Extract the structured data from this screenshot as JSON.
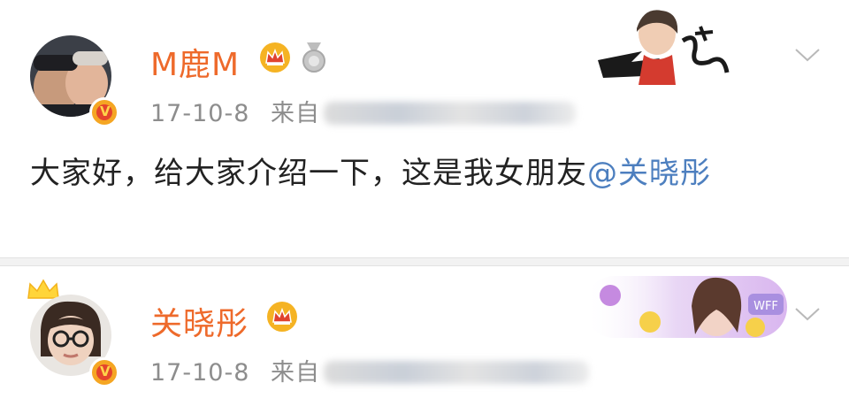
{
  "posts": [
    {
      "username": "M鹿M",
      "timestamp": "17-10-8",
      "source_prefix": "来自",
      "body_prefix": "大家好，给大家介绍一下，这是我女朋友",
      "mention": "@关晓彤"
    },
    {
      "username": "关晓彤",
      "timestamp": "17-10-8",
      "source_prefix": "来自"
    }
  ],
  "colors": {
    "username": "#ee6a2b",
    "mention": "#4d7fbf",
    "meta": "#8d8d8d",
    "verified_badge": "#f5a623"
  },
  "icons": [
    "avatar",
    "verified-badge-icon",
    "crown-member-icon",
    "medal-icon",
    "chevron-down-icon",
    "card-decoration"
  ]
}
